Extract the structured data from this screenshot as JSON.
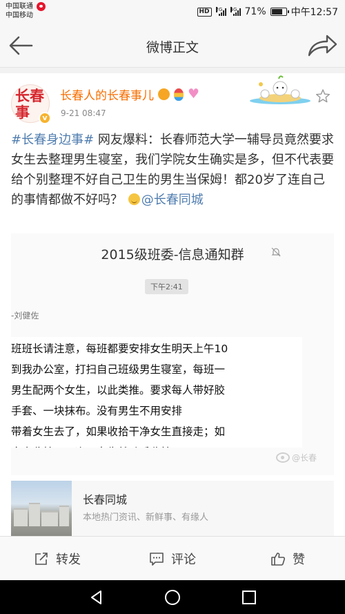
{
  "status_bar": {
    "carrier_1": "中国联通",
    "carrier_2": "中国移动",
    "hd": "HD",
    "net_1": "2G",
    "net_2": "4G",
    "battery": "71%",
    "time": "中午12:57"
  },
  "nav": {
    "title": "微博正文",
    "back_icon": "arrow-left-icon",
    "share_icon": "share-arrow-icon"
  },
  "post": {
    "avatar_text": "长春事",
    "username": "长春人的长春事儿",
    "badges": [
      "emoji-face-icon",
      "hot-air-balloon-icon",
      "heart-icon"
    ],
    "time": "9-21 08:47",
    "text": {
      "hashtag": "#长春身边事#",
      "body": " 网友爆料：长春师范大学一辅导员竟然要求女生去整理男生寝室，我们学院女生确实是多，但不代表要给个别整理不好自己卫生的男生当保姆！都20岁了连自己的事情都做不好吗？ ",
      "mention": "@长春同城"
    },
    "image": {
      "group_title": "2015级班委-信息通知群",
      "chat_time": "下午2:41",
      "sender": "-刘健佐",
      "message": "班班长请注意，每班都要安排女生明天上午10\n到我办公室，打扫自己班级男生寝室，每班一\n男生配两个女生，以此类推。要求每人带好胶\n手套、一块抹布。没有男生不用安排\n带着女生去了，如果收拾干净女生直接走；如\n寝室收拾不干净，女生就动手收拾",
      "watermark": "@长春"
    },
    "source_card": {
      "title": "长春同城",
      "description": "本地热门资讯、新鲜事、有缘人"
    }
  },
  "actions": {
    "repost": "转发",
    "comment": "评论",
    "like": "赞"
  },
  "colors": {
    "username": "#f86e00",
    "link": "#507daf",
    "accent_red": "#e6162d"
  }
}
